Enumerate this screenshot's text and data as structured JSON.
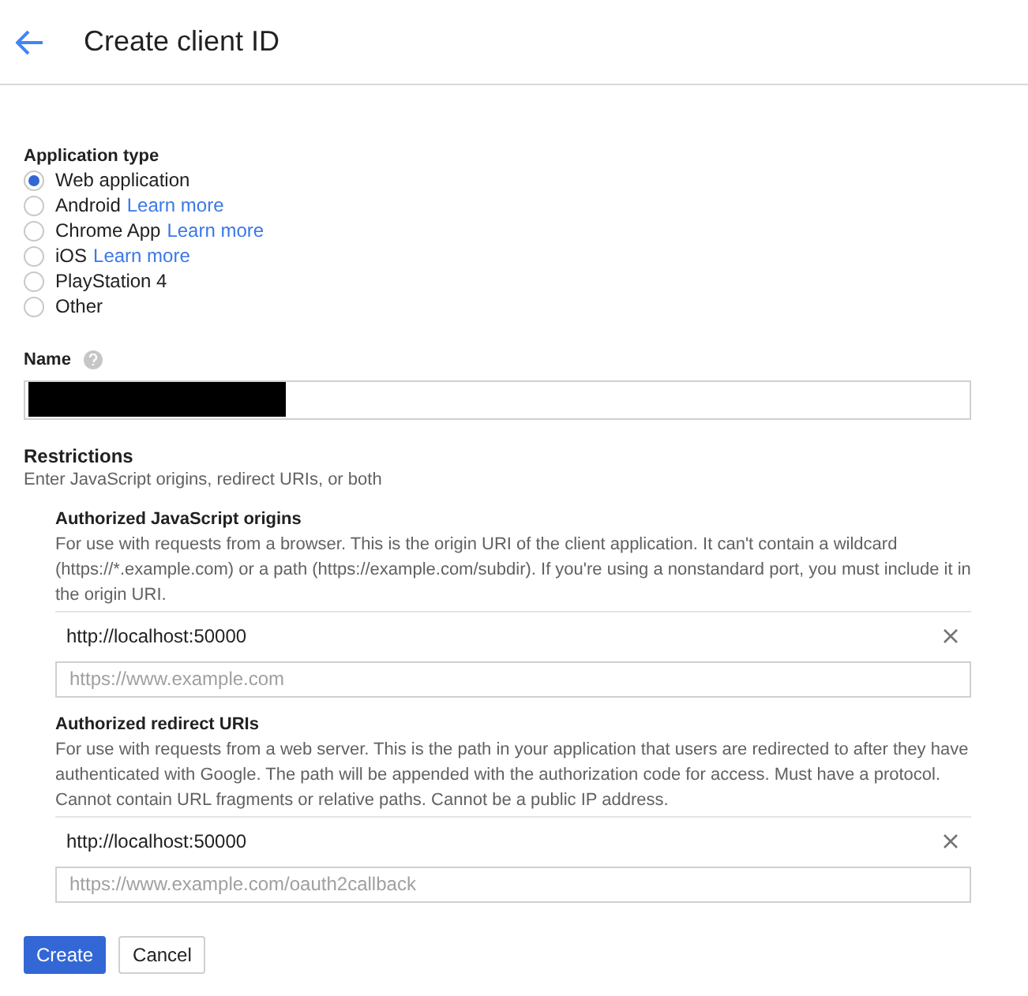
{
  "header": {
    "title": "Create client ID"
  },
  "application_type": {
    "label": "Application type",
    "options": [
      {
        "label": "Web application",
        "selected": true
      },
      {
        "label": "Android",
        "link": "Learn more",
        "selected": false
      },
      {
        "label": "Chrome App",
        "link": "Learn more",
        "selected": false
      },
      {
        "label": "iOS",
        "link": "Learn more",
        "selected": false
      },
      {
        "label": "PlayStation 4",
        "selected": false
      },
      {
        "label": "Other",
        "selected": false
      }
    ]
  },
  "name": {
    "label": "Name",
    "redacted": true
  },
  "restrictions": {
    "title": "Restrictions",
    "description": "Enter JavaScript origins, redirect URIs, or both",
    "sections": [
      {
        "title": "Authorized JavaScript origins",
        "description": "For use with requests from a browser. This is the origin URI of the client application. It can't contain a wildcard (https://*.example.com) or a path (https://example.com/subdir). If you're using a nonstandard port, you must include it in the origin URI.",
        "entries": [
          "http://localhost:50000"
        ],
        "placeholder": "https://www.example.com"
      },
      {
        "title": "Authorized redirect URIs",
        "description": "For use with requests from a web server. This is the path in your application that users are redirected to after they have authenticated with Google. The path will be appended with the authorization code for access. Must have a protocol. Cannot contain URL fragments or relative paths. Cannot be a public IP address.",
        "entries": [
          "http://localhost:50000"
        ],
        "placeholder": "https://www.example.com/oauth2callback"
      }
    ]
  },
  "buttons": {
    "primary": "Create",
    "secondary": "Cancel"
  }
}
